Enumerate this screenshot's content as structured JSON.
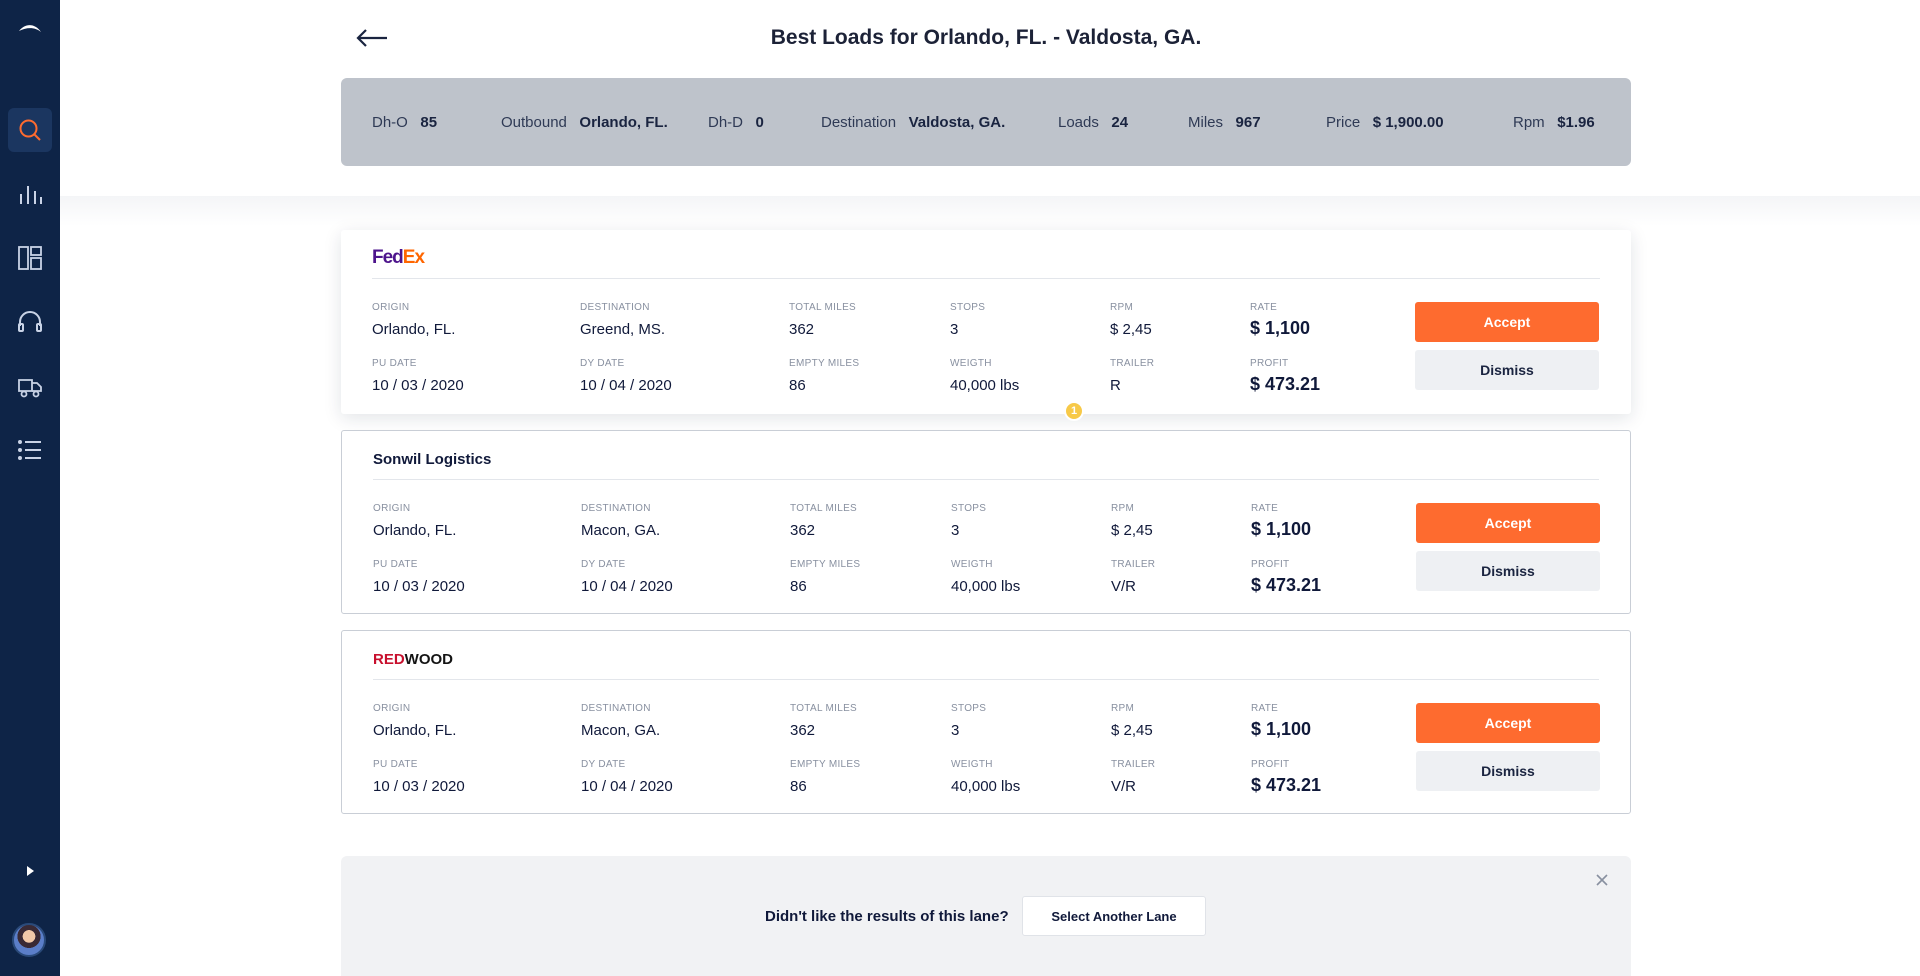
{
  "colors": {
    "sidebar_bg": "#0e2447",
    "accent": "#fe6b2f",
    "summary_bg": "#bec3cb"
  },
  "sidebar": {
    "items": [
      {
        "icon": "search-icon",
        "active": true
      },
      {
        "icon": "bar-chart-icon"
      },
      {
        "icon": "dashboard-icon"
      },
      {
        "icon": "headset-icon"
      },
      {
        "icon": "truck-icon"
      },
      {
        "icon": "list-icon"
      }
    ]
  },
  "header": {
    "title_prefix": "Best Loads for ",
    "title_route": "Orlando, FL. - Valdosta, GA."
  },
  "summary": {
    "dh_o_label": "Dh-O",
    "dh_o": "85",
    "outbound_label": "Outbound",
    "outbound": "Orlando, FL.",
    "dh_d_label": "Dh-D",
    "dh_d": "0",
    "destination_label": "Destination",
    "destination": "Valdosta, GA.",
    "loads_label": "Loads",
    "loads": "24",
    "miles_label": "Miles",
    "miles": "967",
    "price_label": "Price",
    "price": "$ 1,900.00",
    "rpm_label": "Rpm",
    "rpm": "$1.96"
  },
  "labels": {
    "origin": "ORIGIN",
    "destination": "DESTINATION",
    "total_miles": "TOTAL MILES",
    "stops": "STOPS",
    "rpm": "RPM",
    "rate": "RATE",
    "pu_date": "PU DATE",
    "dy_date": "DY DATE",
    "empty_miles": "EMPTY MILES",
    "weigth": "WEIGTH",
    "trailer": "TRAILER",
    "profit": "PROFIT",
    "accept": "Accept",
    "dismiss": "Dismiss"
  },
  "loads": [
    {
      "company": "FedEx",
      "logo_a": "Fed",
      "logo_b": "Ex",
      "origin": "Orlando, FL.",
      "destination": "Greend, MS.",
      "total_miles": "362",
      "stops": "3",
      "rpm": "$ 2,45",
      "rate": "$ 1,100",
      "pu_date": "10 / 03 / 2020",
      "dy_date": "10 / 04 / 2020",
      "empty_miles": "86",
      "weigth": "40,000 lbs",
      "trailer": "R",
      "profit": "$ 473.21"
    },
    {
      "company": "Sonwil Logistics",
      "origin": "Orlando, FL.",
      "destination": "Macon, GA.",
      "total_miles": "362",
      "stops": "3",
      "rpm": "$ 2,45",
      "rate": "$ 1,100",
      "pu_date": "10 / 03 / 2020",
      "dy_date": "10 / 04 / 2020",
      "empty_miles": "86",
      "weigth": "40,000 lbs",
      "trailer": "V/R",
      "profit": "$ 473.21"
    },
    {
      "company": "REDWOOD",
      "logo_a": "RED",
      "logo_b": "WOOD",
      "origin": "Orlando, FL.",
      "destination": "Macon, GA.",
      "total_miles": "362",
      "stops": "3",
      "rpm": "$ 2,45",
      "rate": "$ 1,100",
      "pu_date": "10 / 03 / 2020",
      "dy_date": "10 / 04 / 2020",
      "empty_miles": "86",
      "weigth": "40,000 lbs",
      "trailer": "V/R",
      "profit": "$ 473.21"
    }
  ],
  "badge_count": "1",
  "footer": {
    "question": "Didn't like the results of this lane?",
    "button": "Select Another Lane"
  }
}
